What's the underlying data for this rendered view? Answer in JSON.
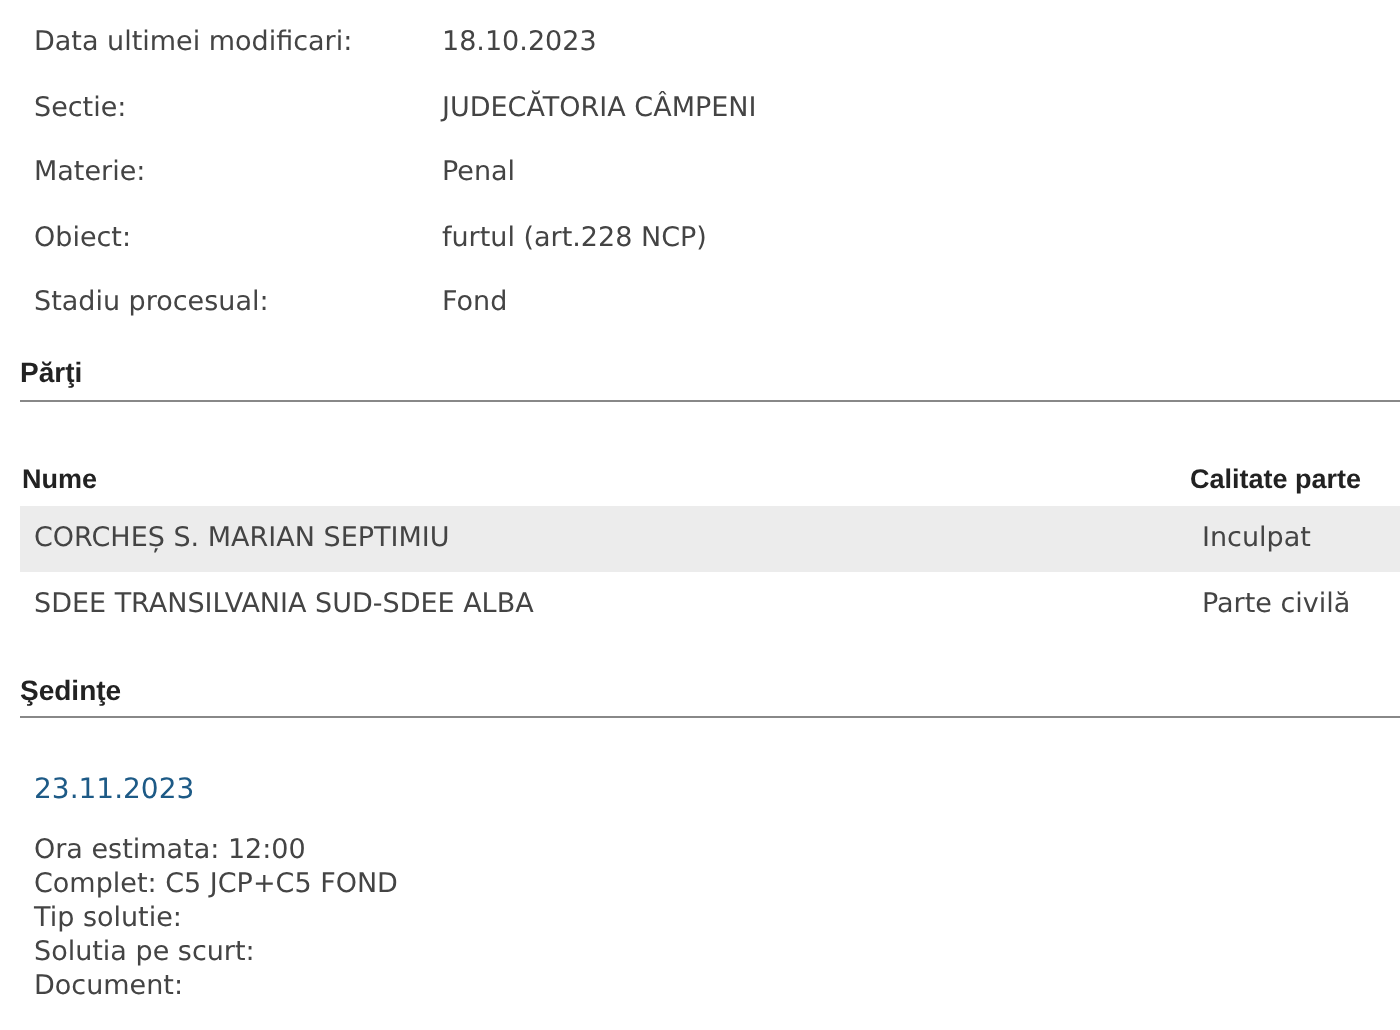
{
  "details": [
    {
      "label": "Data ultimei modificari:",
      "value": "18.10.2023"
    },
    {
      "label": "Sectie:",
      "value": "JUDECĂTORIA CÂMPENI"
    },
    {
      "label": "Materie:",
      "value": "Penal"
    },
    {
      "label": "Obiect:",
      "value": "furtul (art.228 NCP)"
    },
    {
      "label": "Stadiu procesual:",
      "value": "Fond"
    }
  ],
  "parti": {
    "title": "Părţi",
    "columns": [
      "Nume",
      "Calitate parte"
    ],
    "rows": [
      [
        "CORCHEȘ S. MARIAN SEPTIMIU",
        "Inculpat"
      ],
      [
        "SDEE TRANSILVANIA SUD-SDEE ALBA",
        "Parte civilă"
      ]
    ]
  },
  "sedinte": {
    "title": "Şedinţe",
    "sessions": [
      {
        "date": "23.11.2023",
        "lines": [
          "Ora estimata: 12:00",
          "Complet: C5 JCP+C5 FOND",
          "Tip solutie:",
          "Solutia pe scurt:",
          "Document:"
        ]
      }
    ]
  }
}
